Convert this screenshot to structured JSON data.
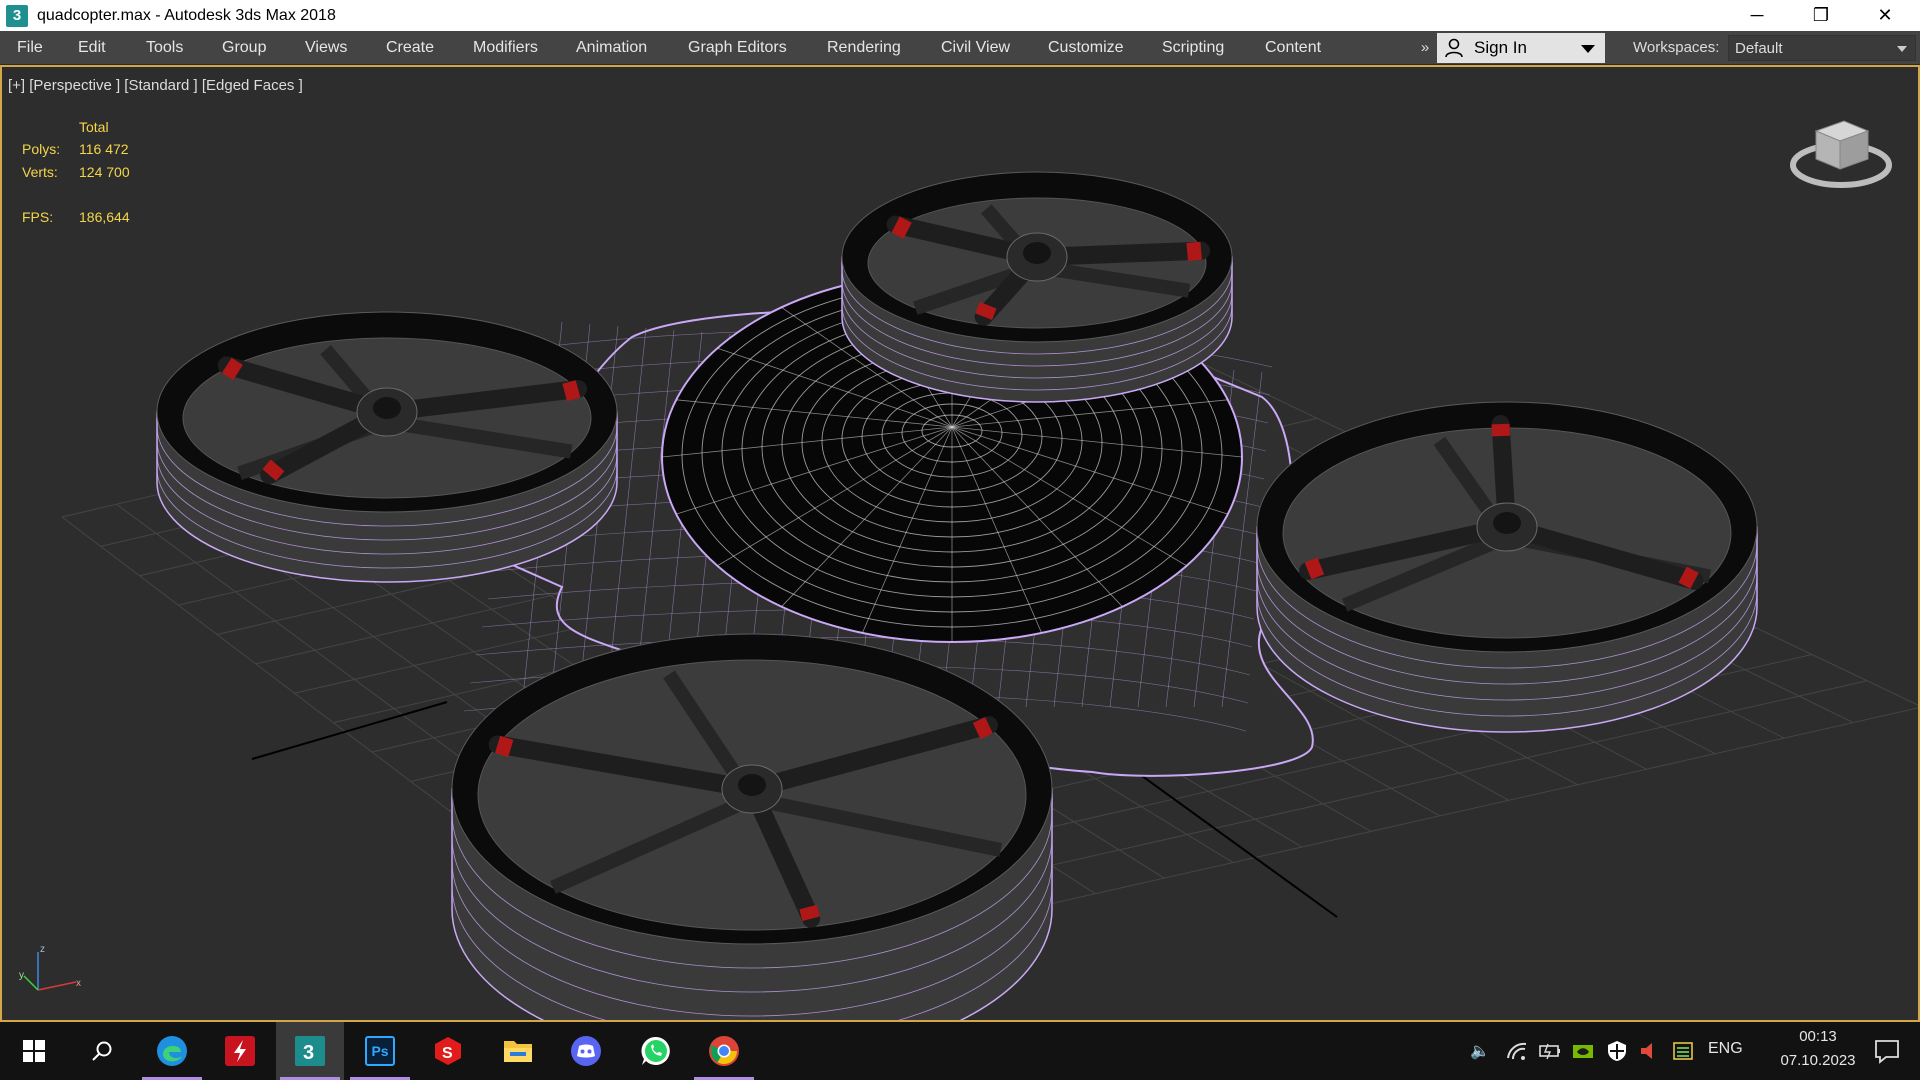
{
  "window": {
    "app_icon_glyph": "3",
    "title": "quadcopter.max - Autodesk 3ds Max 2018",
    "controls": {
      "minimize": "─",
      "restore": "❐",
      "close": "✕"
    }
  },
  "menubar": {
    "items": [
      "File",
      "Edit",
      "Tools",
      "Group",
      "Views",
      "Create",
      "Modifiers",
      "Animation",
      "Graph Editors",
      "Rendering",
      "Civil View",
      "Customize",
      "Scripting",
      "Content"
    ],
    "overflow": "»",
    "sign_in": "Sign In",
    "workspaces_label": "Workspaces:",
    "workspace_value": "Default"
  },
  "viewport": {
    "label": "[+] [Perspective ] [Standard ] [Edged Faces ]",
    "stats": {
      "header": "Total",
      "polys_label": "Polys:",
      "polys_value": "116 472",
      "verts_label": "Verts:",
      "verts_value": "124 700",
      "fps_label": "FPS:",
      "fps_value": "186,644"
    },
    "colors": {
      "background": "#2d2d2d",
      "grid": "#454545",
      "wire": "#c9a8f5",
      "rim": "#0b0b0b",
      "blade": "#1e1e1e",
      "blade_tip": "#b01818",
      "border": "#d4a64a"
    }
  },
  "taskbar": {
    "apps": [
      {
        "name": "start",
        "icon": "windows-logo-icon"
      },
      {
        "name": "search",
        "icon": "search-icon"
      },
      {
        "name": "edge",
        "icon": "edge-browser-icon"
      },
      {
        "name": "flash",
        "icon": "flash-icon"
      },
      {
        "name": "3dsmax",
        "icon": "3dsmax-icon"
      },
      {
        "name": "photoshop",
        "icon": "photoshop-icon",
        "label": "Ps"
      },
      {
        "name": "substance",
        "icon": "substance-icon"
      },
      {
        "name": "explorer",
        "icon": "folder-icon"
      },
      {
        "name": "discord",
        "icon": "discord-icon"
      },
      {
        "name": "whatsapp",
        "icon": "whatsapp-icon"
      },
      {
        "name": "chrome",
        "icon": "chrome-icon"
      }
    ],
    "tray": {
      "language": "ENG",
      "time": "00:13",
      "date": "07.10.2023"
    }
  }
}
